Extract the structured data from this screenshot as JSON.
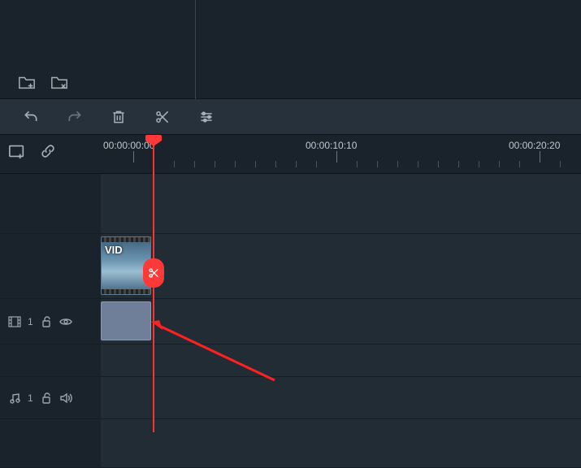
{
  "ruler": {
    "labels": [
      "00:00:00:00",
      "00:00:10:10",
      "00:00:20:20"
    ]
  },
  "tracks": {
    "video": {
      "number": "1"
    },
    "audio": {
      "number": "1"
    }
  },
  "clip": {
    "label": "VID"
  }
}
